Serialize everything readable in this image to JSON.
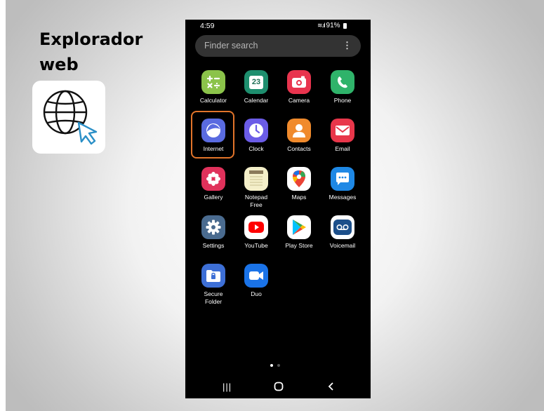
{
  "slide": {
    "title_line1": "Explorador",
    "title_line2": "web",
    "icon": "globe-cursor-icon"
  },
  "status_bar": {
    "time": "4:59",
    "battery": "91%"
  },
  "search": {
    "placeholder": "Finder search",
    "menu_icon": "more-vert-icon"
  },
  "apps": [
    {
      "label": "Calculator",
      "icon": "calculator-icon",
      "color": "#8bc34a"
    },
    {
      "label": "Calendar",
      "icon": "calendar-icon",
      "color": "#1e8e6e",
      "icon_text": "23"
    },
    {
      "label": "Camera",
      "icon": "camera-icon",
      "color": "#e8344e"
    },
    {
      "label": "Phone",
      "icon": "phone-icon",
      "color": "#2fb36a"
    },
    {
      "label": "Internet",
      "icon": "internet-icon",
      "color": "#5a6be0"
    },
    {
      "label": "Clock",
      "icon": "clock-icon",
      "color": "#6b5ce7"
    },
    {
      "label": "Contacts",
      "icon": "contacts-icon",
      "color": "#f08a2c"
    },
    {
      "label": "Email",
      "icon": "email-icon",
      "color": "#e8364a"
    },
    {
      "label": "Gallery",
      "icon": "gallery-icon",
      "color": "#e0315b"
    },
    {
      "label": "Notepad Free",
      "label_line1": "Notepad",
      "label_line2": "Free",
      "icon": "notepad-icon",
      "color": "#f4efc9"
    },
    {
      "label": "Maps",
      "icon": "maps-icon",
      "color": "#ffffff"
    },
    {
      "label": "Messages",
      "icon": "messages-icon",
      "color": "#1e88e5"
    },
    {
      "label": "Settings",
      "icon": "settings-icon",
      "color": "#4a6b8f"
    },
    {
      "label": "YouTube",
      "icon": "youtube-icon",
      "color": "#ffffff"
    },
    {
      "label": "Play Store",
      "icon": "play-store-icon",
      "color": "#ffffff"
    },
    {
      "label": "Voicemail",
      "icon": "voicemail-icon",
      "color": "#ffffff"
    },
    {
      "label": "Secure Folder",
      "label_line1": "Secure",
      "label_line2": "Folder",
      "icon": "secure-folder-icon",
      "color": "#3d6fd6"
    },
    {
      "label": "Duo",
      "icon": "duo-icon",
      "color": "#1a73e8"
    }
  ],
  "highlighted_app": "Internet",
  "highlight_color": "#e2742a",
  "page_indicator": {
    "current": 1,
    "total": 2
  },
  "nav": {
    "recents_icon": "recents-icon",
    "home_icon": "home-icon",
    "back_icon": "back-icon"
  }
}
